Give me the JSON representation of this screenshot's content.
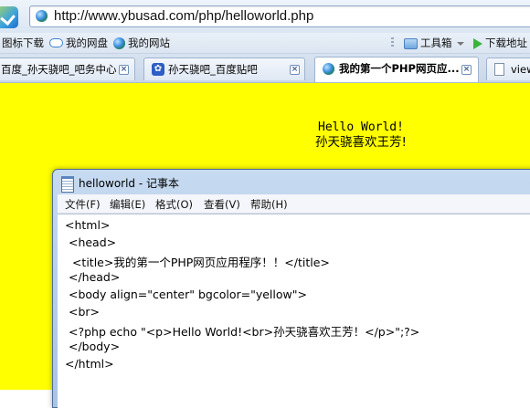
{
  "browser": {
    "url": "http://www.ybusad.com/php/helloworld.php",
    "favorites": [
      {
        "label": "图标下载",
        "icon": "none"
      },
      {
        "label": "我的网盘",
        "icon": "cloud-icon"
      },
      {
        "label": "我的网站",
        "icon": "globe-icon"
      }
    ],
    "toolbox_label": "工具箱",
    "download_label": "下载地址",
    "tabs": [
      {
        "label": "百度_孙天骁吧_吧务中心",
        "active": false
      },
      {
        "label": "孙天骁吧_百度贴吧",
        "active": false
      },
      {
        "label": "我的第一个PHP网页应...",
        "active": true
      },
      {
        "label": "view-",
        "active": false
      }
    ]
  },
  "page": {
    "background": "#ffff00",
    "line1": "Hello World!",
    "line2": "孙天骁喜欢王芳!"
  },
  "notepad": {
    "title": "helloworld - 记事本",
    "menu": [
      "文件(F)",
      "编辑(E)",
      "格式(O)",
      "查看(V)",
      "帮助(H)"
    ],
    "lines": [
      "<html>",
      " <head>",
      "  <title>我的第一个PHP网页应用程序！！</title>",
      " </head>",
      " <body align=\"center\" bgcolor=\"yellow\">",
      " <br>",
      " <?php echo \"<p>Hello World!<br>孙天骁喜欢王芳！</p>\";?>",
      " </body>",
      "</html>"
    ]
  }
}
